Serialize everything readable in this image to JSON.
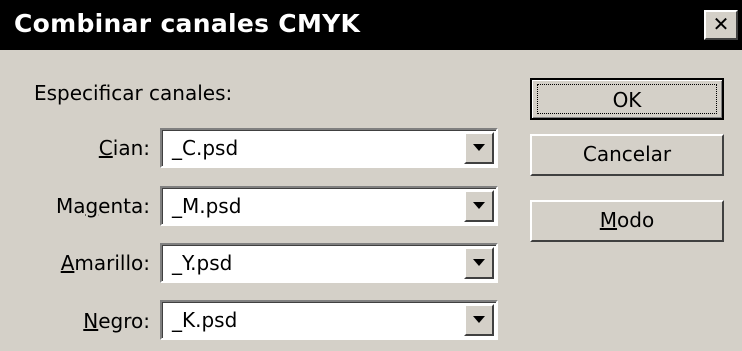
{
  "window": {
    "title": "Combinar canales CMYK"
  },
  "section_label": "Especificar canales:",
  "channels": [
    {
      "label": "Cian:",
      "value": "_C.psd"
    },
    {
      "label": "Magenta:",
      "value": "_M.psd"
    },
    {
      "label": "Amarillo:",
      "value": "_Y.psd"
    },
    {
      "label": "Negro:",
      "value": "_K.psd"
    }
  ],
  "buttons": {
    "ok": "OK",
    "cancel": "Cancelar",
    "mode": "Modo"
  },
  "icons": {
    "close": "close-icon",
    "dropdown": "chevron-down-icon"
  }
}
